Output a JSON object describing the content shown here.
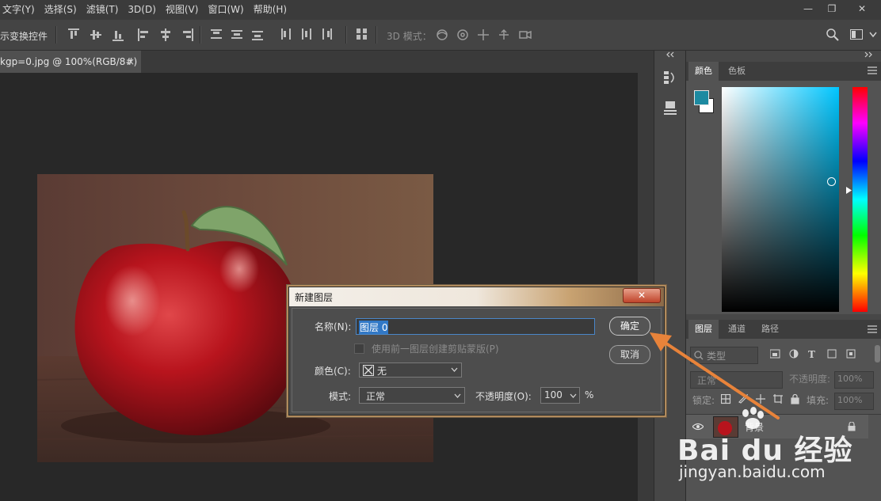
{
  "menu": {
    "items": [
      "文字(Y)",
      "选择(S)",
      "滤镜(T)",
      "3D(D)",
      "视图(V)",
      "窗口(W)",
      "帮助(H)"
    ]
  },
  "window_controls": {
    "minimize": "—",
    "restore": "❐",
    "close": "✕"
  },
  "options_bar": {
    "transform_controls_label": "示变换控件",
    "mode_3d_label": "3D 模式："
  },
  "document": {
    "tab_title": "kgp=0.jpg @ 100%(RGB/8#)",
    "tab_close": "×"
  },
  "color_panel": {
    "tabs": [
      "颜色",
      "色板"
    ],
    "foreground_color": "#1d8aa1",
    "background_color": "#ffffff"
  },
  "layers_panel": {
    "tabs": [
      "图层",
      "通道",
      "路径"
    ],
    "filter_kind": "类型",
    "blend_mode": "正常",
    "opacity_label": "不透明度:",
    "opacity_value": "100%",
    "lock_label": "锁定:",
    "fill_label": "填充:",
    "fill_value": "100%",
    "layer_name": "背景"
  },
  "dialog": {
    "title": "新建图层",
    "name_label": "名称(N):",
    "name_value": "图层 0",
    "clip_checkbox_label": "使用前一图层创建剪贴蒙版(P)",
    "color_label": "颜色(C):",
    "color_value": "无",
    "mode_label": "模式:",
    "mode_value": "正常",
    "opacity_label": "不透明度(O):",
    "opacity_value": "100",
    "opacity_unit": "%",
    "ok_label": "确定",
    "cancel_label": "取消"
  },
  "watermark": {
    "brand": "Bai du 经验",
    "url": "jingyan.baidu.com"
  }
}
